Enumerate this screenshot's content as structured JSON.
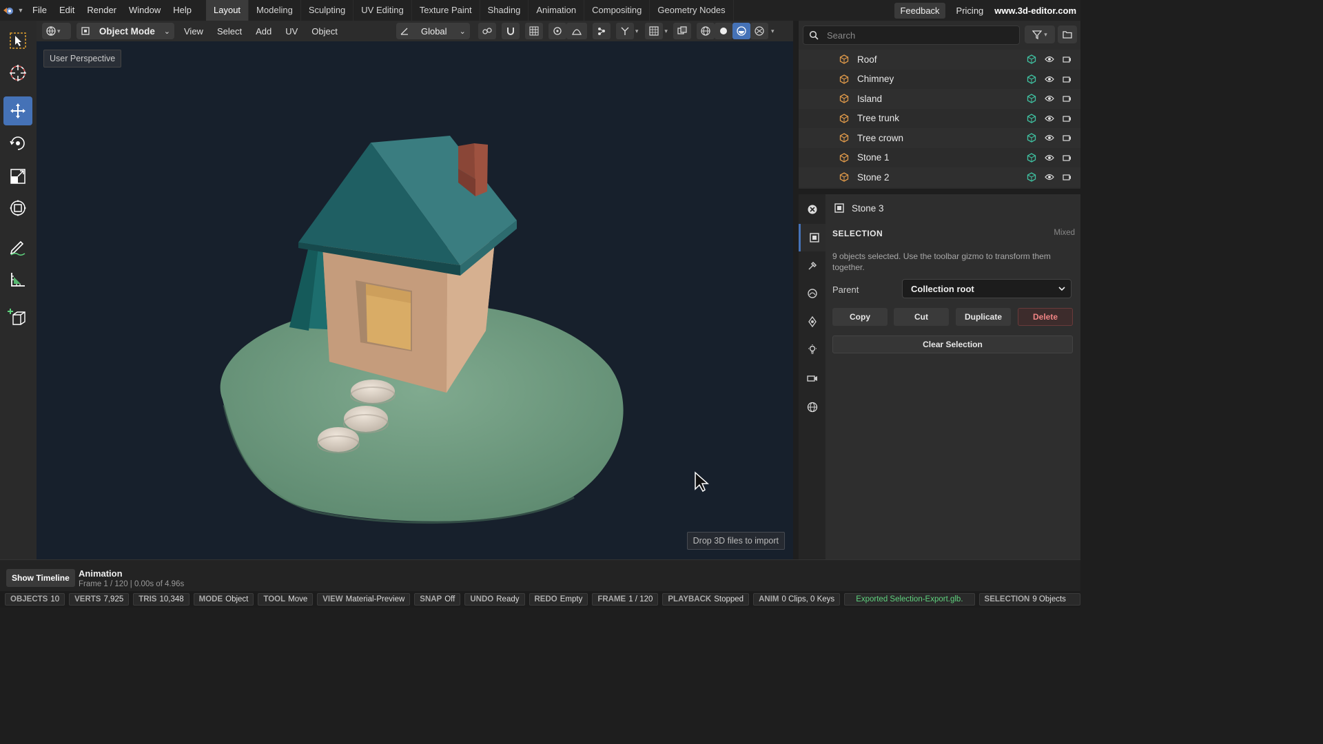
{
  "menubar": {
    "menus": [
      "File",
      "Edit",
      "Render",
      "Window",
      "Help"
    ],
    "workspaces": [
      "Layout",
      "Modeling",
      "Sculpting",
      "UV Editing",
      "Texture Paint",
      "Shading",
      "Animation",
      "Compositing",
      "Geometry Nodes"
    ],
    "active_workspace": "Layout",
    "feedback": "Feedback",
    "pricing": "Pricing",
    "site": "www.3d-editor.com"
  },
  "viewport_header": {
    "mode": "Object Mode",
    "menus": [
      "View",
      "Select",
      "Add",
      "UV",
      "Object"
    ],
    "orientation": "Global"
  },
  "viewport": {
    "perspective_label": "User Perspective",
    "drop_hint": "Drop 3D files to import"
  },
  "outliner": {
    "search_placeholder": "Search",
    "items": [
      {
        "name": "Roof"
      },
      {
        "name": "Chimney"
      },
      {
        "name": "Island"
      },
      {
        "name": "Tree trunk"
      },
      {
        "name": "Tree crown"
      },
      {
        "name": "Stone 1"
      },
      {
        "name": "Stone 2"
      }
    ]
  },
  "properties": {
    "object_name": "Stone 3",
    "section_title": "SELECTION",
    "section_state": "Mixed",
    "description": "9 objects selected. Use the toolbar gizmo to transform them together.",
    "parent_label": "Parent",
    "parent_value": "Collection root",
    "buttons": {
      "copy": "Copy",
      "cut": "Cut",
      "duplicate": "Duplicate",
      "delete": "Delete"
    },
    "clear_selection": "Clear Selection"
  },
  "timeline": {
    "show_button": "Show Timeline",
    "title": "Animation",
    "subtitle": "Frame 1 / 120 | 0.00s of 4.96s"
  },
  "statusbar": {
    "objects": {
      "k": "OBJECTS",
      "v": "10"
    },
    "verts": {
      "k": "VERTS",
      "v": "7,925"
    },
    "tris": {
      "k": "TRIS",
      "v": "10,348"
    },
    "mode": {
      "k": "MODE",
      "v": "Object"
    },
    "tool": {
      "k": "TOOL",
      "v": "Move"
    },
    "view": {
      "k": "VIEW",
      "v": "Material-Preview"
    },
    "snap": {
      "k": "SNAP",
      "v": "Off"
    },
    "undo": {
      "k": "UNDO",
      "v": "Ready"
    },
    "redo": {
      "k": "REDO",
      "v": "Empty"
    },
    "frame": {
      "k": "FRAME",
      "v": "1 / 120"
    },
    "playback": {
      "k": "PLAYBACK",
      "v": "Stopped"
    },
    "anim": {
      "k": "ANIM",
      "v": "0 Clips, 0 Keys"
    },
    "message": "Exported Selection-Export.glb.",
    "selection": {
      "k": "SELECTION",
      "v": "9 Objects"
    }
  },
  "colors": {
    "accent": "#4572b7",
    "status_ok": "#5fd27e",
    "delete": "#f08484",
    "mesh_icon": "#e09a4a",
    "visible_icon": "#3fc0a0"
  }
}
